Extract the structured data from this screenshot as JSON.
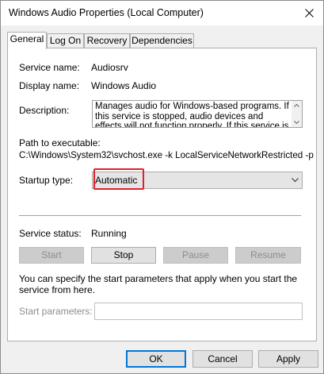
{
  "window": {
    "title": "Windows Audio Properties (Local Computer)"
  },
  "tabs": [
    {
      "label": "General",
      "active": true
    },
    {
      "label": "Log On",
      "active": false
    },
    {
      "label": "Recovery",
      "active": false
    },
    {
      "label": "Dependencies",
      "active": false
    }
  ],
  "general": {
    "service_name_label": "Service name:",
    "service_name": "Audiosrv",
    "display_name_label": "Display name:",
    "display_name": "Windows Audio",
    "description_label": "Description:",
    "description": "Manages audio for Windows-based programs.  If this service is stopped, audio devices and effects will not function properly.  If this service is disabled, any",
    "path_label": "Path to executable:",
    "path": "C:\\Windows\\System32\\svchost.exe -k LocalServiceNetworkRestricted -p",
    "startup_type_label": "Startup type:",
    "startup_type": "Automatic",
    "service_status_label": "Service status:",
    "service_status": "Running",
    "start_label": "Start",
    "stop_label": "Stop",
    "pause_label": "Pause",
    "resume_label": "Resume",
    "hint": "You can specify the start parameters that apply when you start the service from here.",
    "start_params_label": "Start parameters:",
    "start_params_value": ""
  },
  "footer": {
    "ok_label": "OK",
    "cancel_label": "Cancel",
    "apply_label": "Apply"
  },
  "colors": {
    "highlight_border": "#e0202c",
    "default_button_border": "#0078d7"
  },
  "icons": {
    "close": "close-icon",
    "dropdown": "chevron-down-icon",
    "scroll_up": "scroll-up-icon",
    "scroll_down": "scroll-down-icon"
  }
}
